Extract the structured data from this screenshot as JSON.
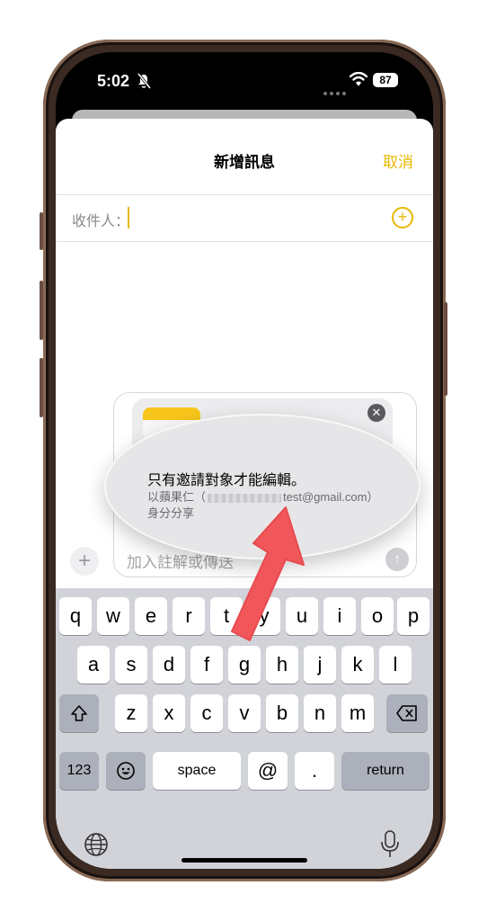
{
  "status": {
    "time": "5:02",
    "battery": "87"
  },
  "sheet": {
    "title": "新增訊息",
    "cancel_label": "取消",
    "to_label": "收件人："
  },
  "composer": {
    "placeholder": "加入註解或傳送"
  },
  "share_popup": {
    "line1": "只有邀請對象才能編輯。",
    "line2_prefix": "以蘋果仁（",
    "line2_suffix": "test@gmail.com）",
    "line3": "身分分享"
  },
  "keyboard": {
    "row1": [
      "q",
      "w",
      "e",
      "r",
      "t",
      "y",
      "u",
      "i",
      "o",
      "p"
    ],
    "row2": [
      "a",
      "s",
      "d",
      "f",
      "g",
      "h",
      "j",
      "k",
      "l"
    ],
    "row3": [
      "z",
      "x",
      "c",
      "v",
      "b",
      "n",
      "m"
    ],
    "numbers_label": "123",
    "space_label": "space",
    "at_label": "@",
    "dot_label": ".",
    "return_label": "return"
  },
  "colors": {
    "accent": "#e6b800",
    "arrow": "#f0565a"
  }
}
